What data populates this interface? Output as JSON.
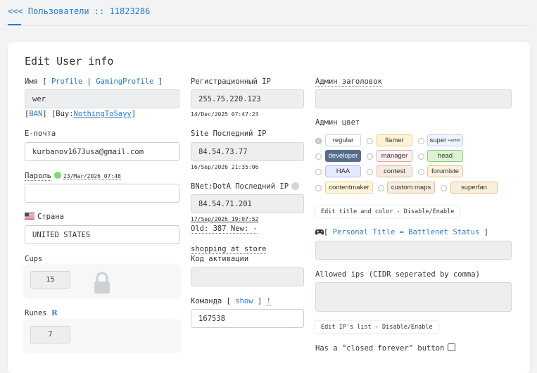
{
  "breadcrumb": {
    "back": "<<<",
    "section": "Пользователи",
    "sep": "::",
    "user_id": "11823286"
  },
  "form": {
    "title": "Edit User info",
    "name": {
      "label": "Имя",
      "lb": "[",
      "profile": "Profile",
      "bar": "|",
      "gaming": "GamingProfile",
      "rb": "]",
      "value": "wer",
      "ban": "BAN",
      "buy_prefix": "[Buy:",
      "buy_name": "NothingToSayy",
      "buy_suffix": "]"
    },
    "email": {
      "label": "E-почта",
      "value": "kurbanov1673usa@gmail.com"
    },
    "password": {
      "label": "Пароль",
      "date": "23/Mar/2026 07:48",
      "value": ""
    },
    "country": {
      "label": "Страна",
      "value": "UNITED STATES"
    },
    "cups": {
      "label": "Cups",
      "value": "15"
    },
    "runes": {
      "label": "Runes",
      "icon": "R",
      "value": "7"
    },
    "reg_ip": {
      "label": "Регистрационный IP",
      "value": "255.75.220.123",
      "date": "14/Dec/2025 07:47:23"
    },
    "site_ip": {
      "label": "Site Последний IP",
      "value": "84.54.73.77",
      "date": "16/Sep/2026 21:35:06"
    },
    "bnet_ip": {
      "label": "BNet:DotA Последний IP",
      "value": "84.54.71.201",
      "date": "17/Sep/2026 19:07:52",
      "old_new": "Old: 387 New: -"
    },
    "shopping": {
      "link": "shopping at store",
      "label": "Код активации",
      "value": ""
    },
    "team": {
      "label": "Команда",
      "lb": "[",
      "show": "show",
      "rb": "]",
      "bang": "!",
      "value": "167538"
    },
    "admin_header": {
      "label": "Админ заголовок",
      "value": ""
    },
    "admin_color": {
      "label": "Админ цвет",
      "colors": {
        "regular": {
          "label": "regular",
          "bg": "#ffffff",
          "border": "#cfd3d7",
          "text": "#333333"
        },
        "flamer": {
          "label": "flamer",
          "bg": "#fff3d6",
          "border": "#f0cc7a",
          "text": "#333333"
        },
        "super": {
          "label": "super",
          "sub": "+admin",
          "bg": "#eef5ff",
          "border": "#bcd3f2",
          "text": "#333333"
        },
        "developer": {
          "label": "developer",
          "bg": "#566e8d",
          "border": "#566e8d",
          "text": "#ffffff"
        },
        "manager": {
          "label": "manager",
          "bg": "#fff0f0",
          "border": "#e8a0a8",
          "text": "#333333"
        },
        "head": {
          "label": "head",
          "bg": "#ddf2d3",
          "border": "#8dcc78",
          "text": "#333333"
        },
        "haa": {
          "label": "HAA",
          "bg": "#e6e9ff",
          "border": "#b4bdf0",
          "text": "#333333"
        },
        "contest": {
          "label": "contest",
          "bg": "#f5ecdf",
          "border": "#d9bf95",
          "text": "#333333"
        },
        "forumiste": {
          "label": "forumiste",
          "bg": "#fdf1e0",
          "border": "#e9c48e",
          "text": "#333333"
        },
        "contentmaker": {
          "label": "contentmaker",
          "bg": "#fff6dc",
          "border": "#e9d08a",
          "text": "#333333"
        },
        "custom_maps": {
          "label": "custom maps",
          "bg": "#f8ecdc",
          "border": "#dfc094",
          "text": "#333333"
        },
        "superfan": {
          "label": "superfan",
          "bg": "#fcefd9",
          "border": "#e3c088",
          "text": "#333333"
        }
      },
      "toggle": "Edit title and color - Disable/Enable"
    },
    "personal_title": {
      "icon": "gamepad-icon",
      "lb": "[",
      "label": "Personal Title = Battlenet Status",
      "rb": "]",
      "value": ""
    },
    "allowed_ips": {
      "label": "Allowed ips (CIDR seperated by comma)",
      "value": "",
      "toggle": "Edit IP's list - Disable/Enable"
    },
    "closed_forever": {
      "label": "Has a \"closed forever\" button"
    }
  },
  "colors": {
    "accent": "#2a7bd1"
  }
}
